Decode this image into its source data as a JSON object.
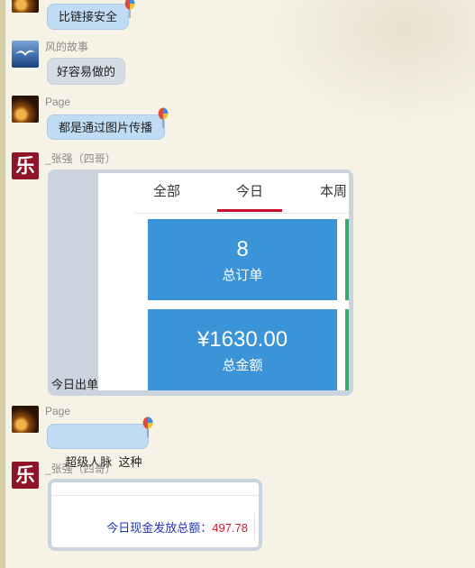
{
  "messages": [
    {
      "sender": "",
      "text": "比链接安全",
      "avatar": "page"
    },
    {
      "sender": "风的故事",
      "text": "好容易做的",
      "avatar": "wind"
    },
    {
      "sender": "Page",
      "text": "都是通过图片传播",
      "avatar": "page"
    },
    {
      "sender": "_张强（四哥）",
      "avatar": "le",
      "card": {
        "tabs": [
          "全部",
          "今日",
          "本周"
        ],
        "active_tab": "今日",
        "stats": [
          {
            "value": "8",
            "label": "总订单"
          },
          {
            "value": "¥1630.00",
            "label": "总金额"
          }
        ],
        "caption": "今日出单"
      }
    },
    {
      "sender": "Page",
      "text": "超级人脉  这种",
      "avatar": "page"
    },
    {
      "sender": "_张强（四哥）",
      "avatar": "le",
      "card": {
        "cash_label": "今日现金发放总额：",
        "cash_amount": "497.78"
      }
    }
  ],
  "avatar_glyph": "乐",
  "colors": {
    "accent_red": "#c8102e",
    "stat_blue": "#3b93d8",
    "bubble_blue": "#bfdcf4",
    "green": "#3aaa6e"
  },
  "icons": [
    "balloon-icon",
    "seagull-icon"
  ]
}
